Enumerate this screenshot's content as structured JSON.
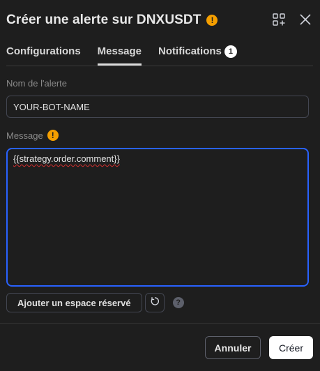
{
  "dialog": {
    "title": "Créer une alerte sur DNXUSDT",
    "title_warning_icon": "exclamation-icon",
    "header_icons": [
      "grid-add-icon",
      "close-icon"
    ]
  },
  "tabs": [
    {
      "label": "Configurations",
      "active": false
    },
    {
      "label": "Message",
      "active": true
    },
    {
      "label": "Notifications",
      "active": false,
      "badge": "1"
    }
  ],
  "form": {
    "name_label": "Nom de l'alerte",
    "name_value": "YOUR-BOT-NAME",
    "message_label": "Message",
    "message_value": "{{strategy.order.comment}}"
  },
  "actions": {
    "add_placeholder_label": "Ajouter un espace réservé",
    "reset_icon": "reset-icon",
    "help_icon": "help-icon",
    "help_symbol": "?",
    "warning_symbol": "!"
  },
  "footer": {
    "cancel_label": "Annuler",
    "create_label": "Créer"
  },
  "colors": {
    "background": "#1e1e1e",
    "focus_border": "#2962ff",
    "warning": "#f59f00",
    "primary_button": "#ffffff"
  }
}
